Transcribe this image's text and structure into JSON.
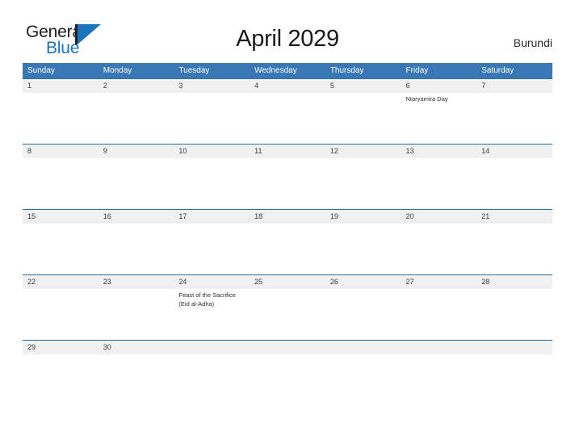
{
  "brand": {
    "word_one": "General",
    "word_two": "Blue",
    "triangle_icon": "blue-flag-triangle-icon",
    "accent_color": "#1b75bc"
  },
  "header": {
    "title": "April 2029",
    "country": "Burundi"
  },
  "theme": {
    "header_blue": "#3a78b5",
    "row_divider_blue": "#2e6da4",
    "date_band_gray": "#f0f0f0",
    "text_dark": "#2b2b2b"
  },
  "weekdays": [
    "Sunday",
    "Monday",
    "Tuesday",
    "Wednesday",
    "Thursday",
    "Friday",
    "Saturday"
  ],
  "weeks": [
    [
      {
        "date": "1",
        "events": []
      },
      {
        "date": "2",
        "events": []
      },
      {
        "date": "3",
        "events": []
      },
      {
        "date": "4",
        "events": []
      },
      {
        "date": "5",
        "events": []
      },
      {
        "date": "6",
        "events": [
          "Ntaryamira Day"
        ]
      },
      {
        "date": "7",
        "events": []
      }
    ],
    [
      {
        "date": "8",
        "events": []
      },
      {
        "date": "9",
        "events": []
      },
      {
        "date": "10",
        "events": []
      },
      {
        "date": "11",
        "events": []
      },
      {
        "date": "12",
        "events": []
      },
      {
        "date": "13",
        "events": []
      },
      {
        "date": "14",
        "events": []
      }
    ],
    [
      {
        "date": "15",
        "events": []
      },
      {
        "date": "16",
        "events": []
      },
      {
        "date": "17",
        "events": []
      },
      {
        "date": "18",
        "events": []
      },
      {
        "date": "19",
        "events": []
      },
      {
        "date": "20",
        "events": []
      },
      {
        "date": "21",
        "events": []
      }
    ],
    [
      {
        "date": "22",
        "events": []
      },
      {
        "date": "23",
        "events": []
      },
      {
        "date": "24",
        "events": [
          "Feast of the Sacrifice (Eid al-Adha)"
        ]
      },
      {
        "date": "25",
        "events": []
      },
      {
        "date": "26",
        "events": []
      },
      {
        "date": "27",
        "events": []
      },
      {
        "date": "28",
        "events": []
      }
    ],
    [
      {
        "date": "29",
        "events": []
      },
      {
        "date": "30",
        "events": []
      },
      {
        "date": "",
        "events": []
      },
      {
        "date": "",
        "events": []
      },
      {
        "date": "",
        "events": []
      },
      {
        "date": "",
        "events": []
      },
      {
        "date": "",
        "events": []
      }
    ]
  ]
}
